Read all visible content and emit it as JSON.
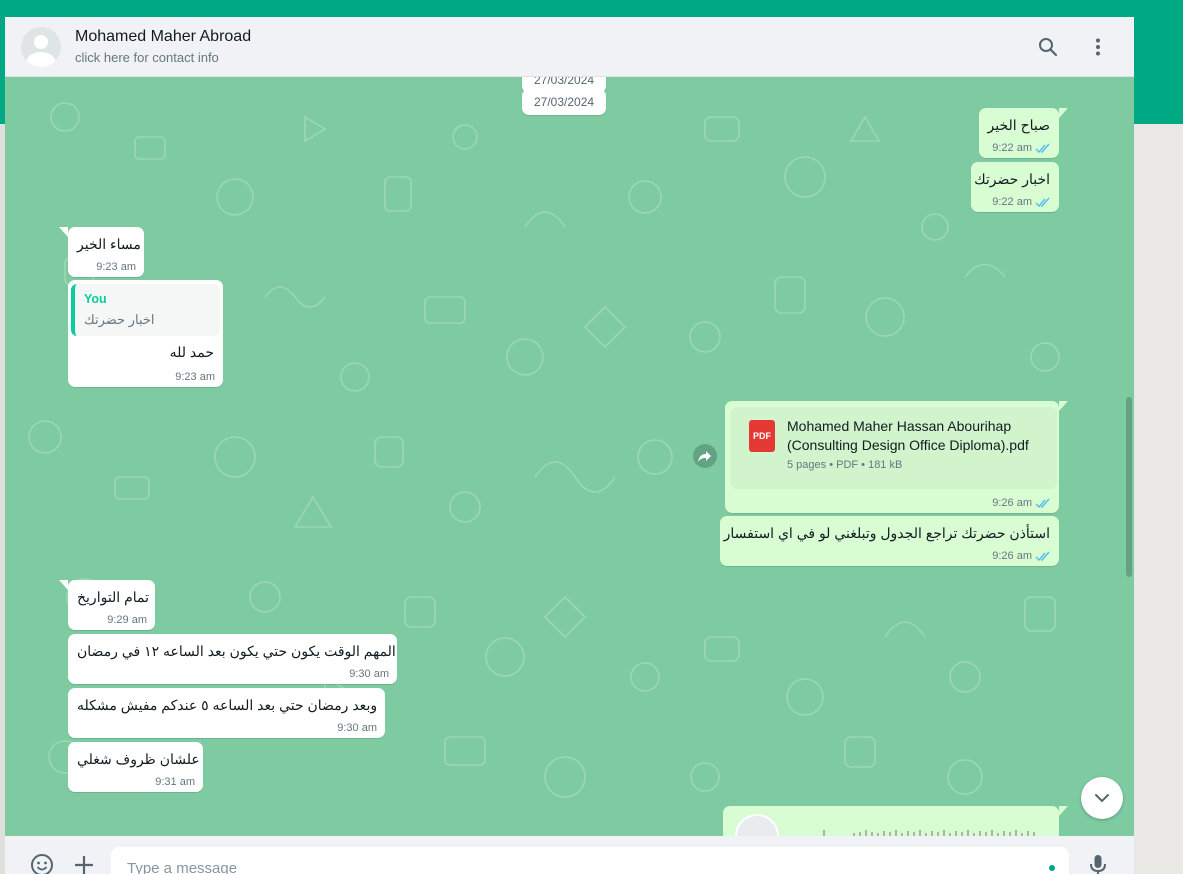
{
  "colors": {
    "accent": "#00a884",
    "wallpaper": "#7ecba2",
    "incoming_bubble": "#ffffff",
    "outgoing_bubble": "#d9fdd3",
    "read_tick": "#53bdeb"
  },
  "header": {
    "contact_name": "Mohamed Maher Abroad",
    "contact_sub": "click here for contact info",
    "icons": [
      "search-icon",
      "menu-icon"
    ]
  },
  "date_chips": [
    "27/03/2024",
    "27/03/2024"
  ],
  "messages": [
    {
      "dir": "out",
      "text": "صباح الخير",
      "time": "9:22 am"
    },
    {
      "dir": "out",
      "text": "اخبار حضرتك",
      "time": "9:22 am"
    },
    {
      "dir": "in",
      "text": "مساء الخير",
      "time": "9:23 am"
    },
    {
      "dir": "in",
      "quote_author": "You",
      "quote_text": "اخبار حضرتك",
      "text": "حمد لله",
      "time": "9:23 am"
    },
    {
      "dir": "out",
      "type": "document",
      "doc_name": "Mohamed Maher Hassan Abourihap (Consulting Design Office Diploma).pdf",
      "doc_info": "5 pages • PDF • 181 kB",
      "doc_badge": "PDF",
      "time": "9:26 am"
    },
    {
      "dir": "out",
      "text": "استأذن حضرتك تراجع الجدول وتبلغني لو في اي استفسار",
      "time": "9:26 am"
    },
    {
      "dir": "in",
      "text": "تمام التواريخ",
      "time": "9:29 am"
    },
    {
      "dir": "in",
      "text": "المهم الوقت يكون حتي يكون بعد الساعه ١٢ في رمضان",
      "time": "9:30 am"
    },
    {
      "dir": "in",
      "text": "وبعد رمضان حتي بعد الساعه ٥ عندكم مفيش مشكله",
      "time": "9:30 am"
    },
    {
      "dir": "in",
      "text": "علشان ظروف شغلي",
      "time": "9:31 am"
    }
  ],
  "compose": {
    "placeholder": "Type a message",
    "icons": [
      "emoji-icon",
      "attach-plus-icon",
      "microphone-icon"
    ]
  }
}
